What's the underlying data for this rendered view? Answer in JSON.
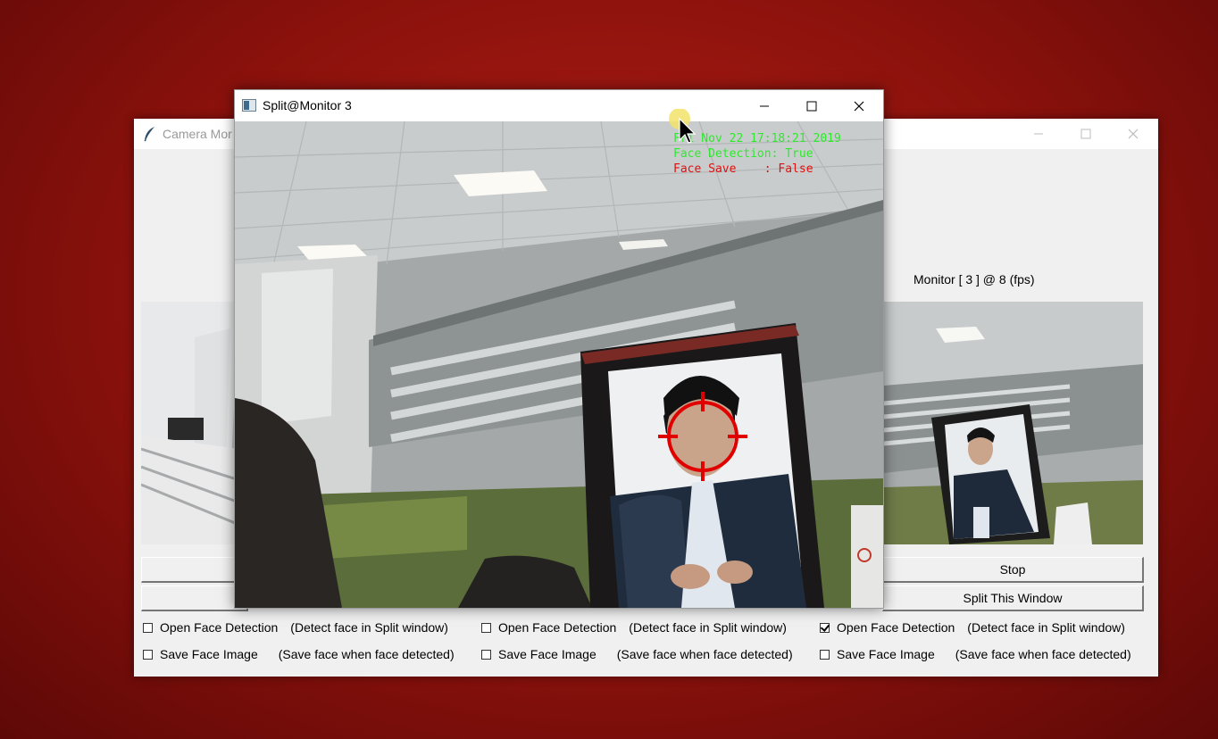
{
  "main_window": {
    "title": "Camera Mor",
    "monitor_label": "Monitor [ 3 ] @  8 (fps)",
    "buttons": {
      "stop": "Stop",
      "split": "Split This Window"
    },
    "panels": [
      {
        "face_detection": {
          "label": "Open Face Detection",
          "hint": "(Detect face in Split window)",
          "checked": false
        },
        "save_face": {
          "label": "Save Face Image",
          "hint": "(Save face when face detected)",
          "checked": false
        }
      },
      {
        "face_detection": {
          "label": "Open Face Detection",
          "hint": "(Detect face in Split window)",
          "checked": false
        },
        "save_face": {
          "label": "Save Face Image",
          "hint": "(Save face when face detected)",
          "checked": false
        }
      },
      {
        "face_detection": {
          "label": "Open Face Detection",
          "hint": "(Detect face in Split window)",
          "checked": true
        },
        "save_face": {
          "label": "Save Face Image",
          "hint": "(Save face when face detected)",
          "checked": false
        }
      }
    ]
  },
  "split_window": {
    "title": "Split@Monitor 3",
    "overlay": {
      "timestamp": "Fri Nov 22 17:18:21 2019",
      "face_detection": "Face Detection: True",
      "face_save": "Face Save    : False"
    }
  },
  "colors": {
    "desktop": "#9e1a13",
    "overlay_green": "#2ee82e",
    "overlay_red": "#e01010",
    "target_red": "#e00000"
  },
  "icons": {
    "main_window": "feather-icon",
    "split_window": "app-icon",
    "controls": [
      "minimize-icon",
      "maximize-icon",
      "close-icon"
    ],
    "target": "crosshair-icon",
    "pointer": "mouse-cursor-icon"
  }
}
